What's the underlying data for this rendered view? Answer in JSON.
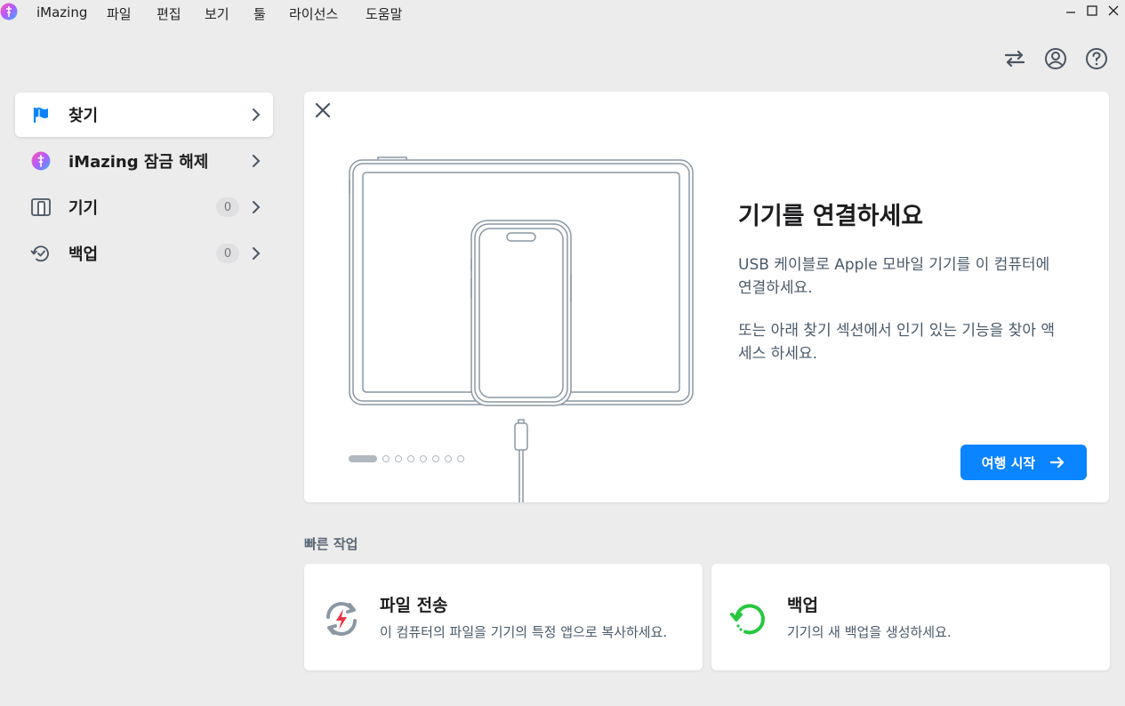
{
  "menubar": {
    "app_name": "iMazing",
    "items": [
      "파일",
      "편집",
      "보기",
      "툴",
      "라이선스",
      "도움말"
    ]
  },
  "sidebar": {
    "items": [
      {
        "label": "찾기",
        "icon": "flag-icon",
        "active": true
      },
      {
        "label": "iMazing 잠금 해제",
        "icon": "imazing-logo-icon"
      },
      {
        "label": "기기",
        "icon": "devices-icon",
        "count": "0"
      },
      {
        "label": "백업",
        "icon": "backup-clock-icon",
        "count": "0"
      }
    ]
  },
  "hero": {
    "title": "기기를 연결하세요",
    "paragraph1": "USB 케이블로 Apple 모바일 기기를 이 컴퓨터에 연결하세요.",
    "paragraph2": "또는 아래 찾기 섹션에서 인기 있는 기능을 찾아 액세스 하세요.",
    "start_button": "여행 시작",
    "dots_total": 8,
    "dots_active": 1
  },
  "quick_actions": {
    "title": "빠른 작업",
    "cards": [
      {
        "name": "파일 전송",
        "desc": "이 컴퓨터의 파일을 기기의 특정 앱으로 복사하세요.",
        "icon": "file-transfer-icon"
      },
      {
        "name": "백업",
        "desc": "기기의 새 백업을 생성하세요.",
        "icon": "backup-icon"
      }
    ]
  },
  "colors": {
    "accent": "#0a84ff",
    "transfer_red": "#e8354a",
    "backup_green": "#28c840"
  }
}
